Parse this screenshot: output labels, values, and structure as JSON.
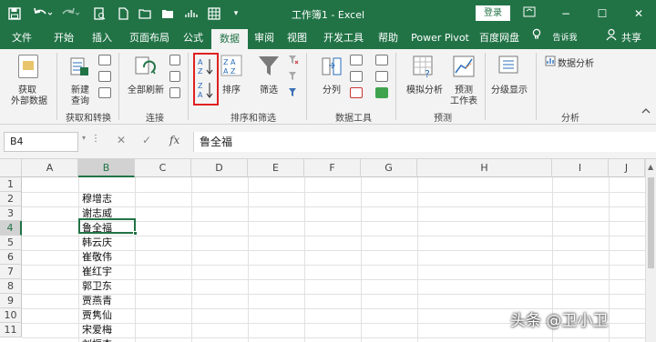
{
  "titlebar": {
    "title": "工作簿1 - Excel",
    "login_label": "登录",
    "save_icon": "save-icon",
    "undo_icon": "undo-icon",
    "redo_icon": "redo-icon",
    "window_controls": [
      "−",
      "☐",
      "✕"
    ],
    "restore_icon": "ribbon-display-icon"
  },
  "tabs": [
    {
      "label": "文件",
      "active": false
    },
    {
      "label": "开始",
      "active": false
    },
    {
      "label": "插入",
      "active": false
    },
    {
      "label": "页面布局",
      "active": false
    },
    {
      "label": "公式",
      "active": false
    },
    {
      "label": "数据",
      "active": true
    },
    {
      "label": "审阅",
      "active": false
    },
    {
      "label": "视图",
      "active": false
    },
    {
      "label": "开发工具",
      "active": false
    },
    {
      "label": "帮助",
      "active": false
    },
    {
      "label": "Power Pivot",
      "active": false
    },
    {
      "label": "百度网盘",
      "active": false
    },
    {
      "label": "告诉我",
      "active": false
    }
  ],
  "share_label": "共享",
  "ribbon": {
    "get_external_data": [
      "获取",
      "外部数据"
    ],
    "new_query": [
      "新建",
      "查询"
    ],
    "refresh_all": "全部刷新",
    "sort_label": "排序",
    "filter_label": "筛选",
    "split_label": "分列",
    "whatif_label": "模拟分析",
    "forecast_label": [
      "预测",
      "工作表"
    ],
    "outline_label": "分级显示",
    "data_analysis_label": "数据分析",
    "groups": [
      "获取和转换",
      "连接",
      "排序和筛选",
      "数据工具",
      "预测",
      "分析"
    ]
  },
  "formula_bar": {
    "name_box": "B4",
    "fx_label": "fx",
    "content": "鲁全福"
  },
  "columns": [
    "A",
    "B",
    "C",
    "D",
    "E",
    "F",
    "G",
    "H",
    "I",
    "J"
  ],
  "selected_column": "B",
  "selected_row": "4",
  "rows": [
    "1",
    "2",
    "3",
    "4",
    "5",
    "6",
    "7",
    "8",
    "9",
    "10",
    "11"
  ],
  "cells_B": [
    "",
    "穆增志",
    "谢志威",
    "鲁全福",
    "韩云庆",
    "崔敬伟",
    "崔红宇",
    "郭卫东",
    "贾燕青",
    "贾隽仙",
    "宋爱梅",
    "刘振杰"
  ],
  "watermark": "头条 @卫小卫",
  "accent_color": "#217346",
  "highlight_color": "#e02020"
}
